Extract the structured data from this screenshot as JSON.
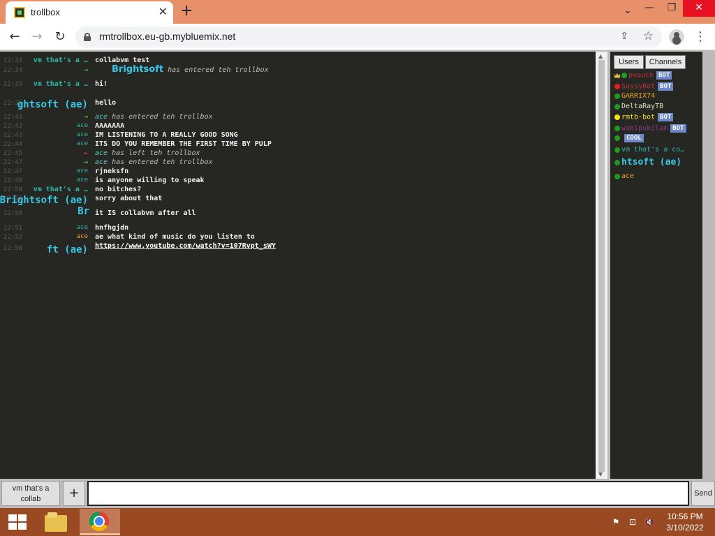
{
  "browser": {
    "tab_title": "trollbox",
    "tab_close": "✕",
    "new_tab": "+",
    "url": "rmtrollbox.eu-gb.mybluemix.net",
    "window_chevron": "⌄",
    "window_minimize": "—",
    "window_maximize": "❐",
    "window_close": "✕"
  },
  "chat": {
    "messages": [
      {
        "time": "22:34",
        "nick": "vm that's a …",
        "text": "collabvm test"
      },
      {
        "time": "22:34",
        "nick": "→",
        "join_name": "Brightsoft",
        "text": "has entered teh trollbox"
      },
      {
        "time": "22:35",
        "nick": "vm that's a …",
        "text": "hi!"
      },
      {
        "time": "22:35",
        "nick": "ghtsoft (ae)",
        "text": "hello"
      },
      {
        "time": "22:43",
        "nick": "→",
        "who": "ace",
        "text": "has entered teh trollbox"
      },
      {
        "time": "22:43",
        "nick": "ace",
        "text": "AAAAAAA"
      },
      {
        "time": "22:43",
        "nick": "ace",
        "text": "IM LISTENING TO A REALLY GOOD SONG"
      },
      {
        "time": "22:44",
        "nick": "ace",
        "text": "ITS DO YOU REMEMBER THE FIRST TIME BY PULP"
      },
      {
        "time": "22:45",
        "nick": "←",
        "who": "ace",
        "text": "has left teh trollbox"
      },
      {
        "time": "22:47",
        "nick": "→",
        "who": "ace",
        "text": "has entered teh trollbox"
      },
      {
        "time": "22:47",
        "nick": "ace",
        "text": "rjneksfn"
      },
      {
        "time": "22:48",
        "nick": "ace",
        "text": "is anyone willing to speak"
      },
      {
        "time": "22:50",
        "nick": "vm that's a …",
        "text": "no bitches?"
      },
      {
        "time": "22:50",
        "nick": "Brightsoft (ae)",
        "text": "sorry about that"
      },
      {
        "time": "22:50",
        "nick": "Br",
        "text": "it IS collabvm after all"
      },
      {
        "time": "22:51",
        "nick": "ace",
        "text": "hnfhgjdn"
      },
      {
        "time": "22:52",
        "nick": "ace",
        "text": "ae what kind of music do you listen to"
      },
      {
        "time": "22:56",
        "nick": "ft (ae)",
        "text": "https://www.youtube.com/watch?v=107Rvpt_sWY"
      }
    ]
  },
  "sidebar": {
    "tab_users": "Users",
    "tab_channels": "Channels",
    "users": [
      {
        "name": "pvauck",
        "color": "#c0323a",
        "dot": "green",
        "crown": true,
        "badge": "BOT"
      },
      {
        "name": "SussyBot",
        "color": "#c0323a",
        "dot": "red",
        "badge": "BOT"
      },
      {
        "name": "GARRIX74",
        "color": "#e8a020",
        "dot": "green"
      },
      {
        "name": "DeltaRayTB",
        "color": "#e0e0c0",
        "dot": "green"
      },
      {
        "name": "rmtb-bot",
        "color": "#f0e020",
        "dot": "yellow",
        "badge": "BOT"
      },
      {
        "name": "wakipukilam",
        "color": "#8a3a8a",
        "dot": "green",
        "badge": "BOT"
      },
      {
        "name": "",
        "color": "#3a8a3a",
        "dot": "green",
        "badge": "COOL"
      },
      {
        "name": "vm that's a co…",
        "color": "#2ab8a8",
        "dot": "green"
      },
      {
        "name": "htsoft (ae)",
        "color": "#35c8e6",
        "dot": "green",
        "big": true
      },
      {
        "name": "ace",
        "color": "#e8a020",
        "dot": "green"
      }
    ]
  },
  "inputbar": {
    "channel_label": "vm that's a collab",
    "plus": "+",
    "input_value": "",
    "send": "Send"
  },
  "taskbar": {
    "time": "10:56 PM",
    "date": "3/10/2022"
  },
  "colors": {
    "chrome_tabstrip": "#e8906a",
    "taskbar": "#9a4a23",
    "chat_bg": "#262622"
  }
}
